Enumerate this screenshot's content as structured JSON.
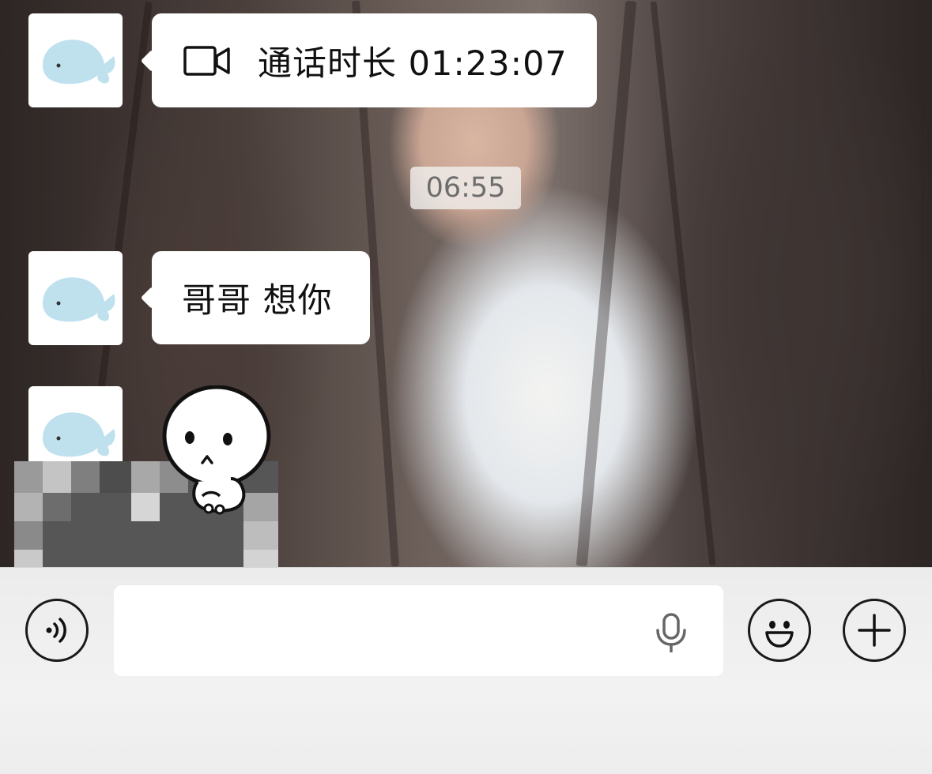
{
  "messages": [
    {
      "type": "video-call",
      "icon": "video-camera-icon",
      "text": "通话时长 01:23:07"
    },
    {
      "type": "text",
      "text": "哥哥 想你"
    },
    {
      "type": "sticker",
      "icon": "sitting-face-sticker"
    }
  ],
  "timestamp": "06:55",
  "input_bar": {
    "voice_icon": "voice-icon",
    "text_value": "",
    "mic_icon": "microphone-icon",
    "emoji_icon": "smiley-icon",
    "plus_icon": "plus-icon"
  },
  "colors": {
    "bubble": "#ffffff",
    "timestamp_text": "#6d6d6d",
    "avatar_whale": "#bfe1ee",
    "input_bar_bg": "#ececec"
  }
}
